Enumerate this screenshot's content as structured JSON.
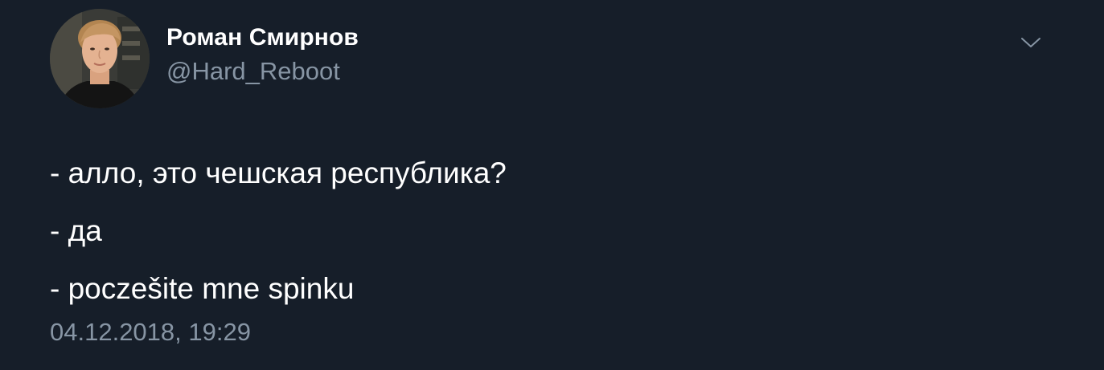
{
  "author": {
    "name": "Роман Смирнов",
    "handle": "@Hard_Reboot"
  },
  "icons": {
    "more": "chevron-down-icon",
    "avatar": "avatar"
  },
  "tweet": {
    "lines": [
      "- алло, это чешская республика?",
      "- да",
      "- poczešite mne spinku"
    ],
    "timestamp": "04.12.2018, 19:29"
  },
  "colors": {
    "background": "#161e29",
    "text_primary": "#ffffff",
    "text_secondary": "#8795a4"
  }
}
